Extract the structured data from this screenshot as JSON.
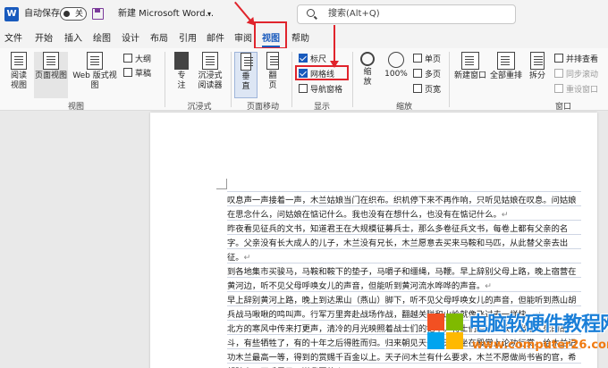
{
  "titlebar": {
    "autosave_label": "自动保存",
    "autosave_state": "关",
    "doc_title": "新建 Microsoft Word...",
    "search_placeholder": "搜索(Alt+Q)"
  },
  "tabs": [
    "文件",
    "开始",
    "插入",
    "绘图",
    "设计",
    "布局",
    "引用",
    "邮件",
    "审阅",
    "视图",
    "帮助"
  ],
  "active_tab": "视图",
  "ribbon": {
    "views": {
      "read_mode": "阅读\n视图",
      "print_layout": "页面视图",
      "web_layout": "Web 版式视图",
      "outline": "大纲",
      "draft": "草稿",
      "group_label": "视图"
    },
    "immersive": {
      "focus": "专\n注",
      "reader": "沉浸式\n阅读器",
      "group_label": "沉浸式"
    },
    "page_movement": {
      "vertical": "垂\n直",
      "side_to_side": "翻\n页",
      "group_label": "页面移动"
    },
    "show": {
      "ruler": "标尺",
      "gridlines": "网格线",
      "nav_pane": "导航窗格",
      "group_label": "显示",
      "ruler_checked": true,
      "gridlines_checked": true,
      "nav_pane_checked": false
    },
    "zoom": {
      "zoom": "缩\n放",
      "hundred": "100%",
      "one_page": "单页",
      "multi_page": "多页",
      "page_width": "页宽",
      "group_label": "缩放"
    },
    "window": {
      "new_window": "新建窗口",
      "arrange_all": "全部重排",
      "split": "拆分",
      "side_by_side": "并排查看",
      "sync_scroll": "同步滚动",
      "reset_position": "重设窗口",
      "group_label": "窗口"
    }
  },
  "document": {
    "paragraphs": [
      "叹息声一声接着一声，木兰姑娘当门在织布。织机停下来不再作响，只听见姑娘在叹息。问姑娘在思念什么，问姑娘在惦记什么。我也没有在想什么，也没有在惦记什么。",
      "昨夜看见征兵的文书，知道君王在大规模征募兵士，那么多卷征兵文书，每卷上都有父亲的名字。父亲没有长大成人的儿子，木兰没有兄长，木兰愿意去买来马鞍和马匹，从此替父亲去出征。",
      "到各地集市买骏马，马鞍和鞍下的垫子，马嚼子和缰绳，马鞭。早上辞别父母上路，晚上宿营在黄河边，听不见父母呼唤女儿的声音，但能听到黄河流水哗哗的声音。",
      "早上辞别黄河上路，晚上到达黑山（燕山）脚下，听不见父母呼唤女儿的声音，但能听到燕山胡兵战马啾啾的鸣叫声。行军万里奔赴战场作战，翻越关隘和山岭就像飞过去一样快。",
      "北方的寒风中传来打更声，清冷的月光映照着战士们的铠甲。将士们经过无数次出生入死的战斗，有些牺牲了，有的十年之后得胜而归。归来朝见天子，天子坐在殿堂上论功行赏。给木兰记功木兰最高一等，得到的赏赐千百金以上。天子问木兰有什么要求，木兰不愿做尚书省的官，希望骑上一匹千里马，送我回故乡。"
    ]
  },
  "watermark": {
    "title": "电脑软硬件教程网",
    "url": "www.computer26.com"
  }
}
